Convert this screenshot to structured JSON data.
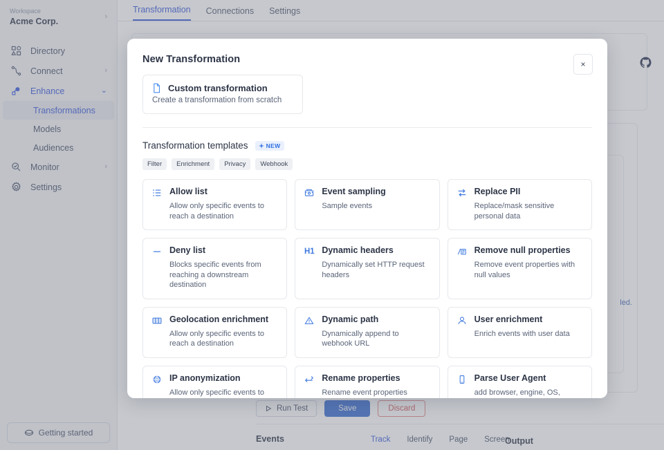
{
  "sidebar": {
    "workspace_label": "Workspace",
    "workspace_name": "Acme Corp.",
    "items": [
      {
        "label": "Directory",
        "icon": "directory-icon",
        "chevron": ""
      },
      {
        "label": "Connect",
        "icon": "connect-icon",
        "chevron": "›"
      },
      {
        "label": "Enhance",
        "icon": "enhance-icon",
        "chevron": "∨"
      },
      {
        "label": "Monitor",
        "icon": "monitor-icon",
        "chevron": "›"
      },
      {
        "label": "Settings",
        "icon": "settings-icon",
        "chevron": ""
      }
    ],
    "sub_items": [
      {
        "label": "Transformations",
        "selected": true
      },
      {
        "label": "Models",
        "selected": false
      },
      {
        "label": "Audiences",
        "selected": false
      }
    ],
    "getting_started": "Getting started"
  },
  "main": {
    "tabs": [
      {
        "label": "Transformation",
        "active": true
      },
      {
        "label": "Connections",
        "active": false
      },
      {
        "label": "Settings",
        "active": false
      }
    ],
    "faint_text": "led.",
    "actions": {
      "run_test": "Run Test",
      "save": "Save",
      "discard": "Discard"
    },
    "events": {
      "label": "Events",
      "output_label": "Output",
      "tabs": [
        {
          "label": "Track",
          "active": true
        },
        {
          "label": "Identify",
          "active": false
        },
        {
          "label": "Page",
          "active": false
        },
        {
          "label": "Screen",
          "active": false
        }
      ]
    }
  },
  "modal": {
    "title": "New Transformation",
    "close_label": "×",
    "custom": {
      "title": "Custom transformation",
      "subtitle": "Create a transformation from scratch",
      "icon": "file-icon"
    },
    "templates_heading": "Transformation templates",
    "new_badge": "NEW",
    "chips": [
      "Filter",
      "Enrichment",
      "Privacy",
      "Webhook"
    ],
    "templates": [
      {
        "title": "Allow list",
        "subtitle": "Allow only specific events to reach a destination",
        "icon": "list-icon"
      },
      {
        "title": "Event sampling",
        "subtitle": "Sample events",
        "icon": "sampling-icon"
      },
      {
        "title": "Replace PII",
        "subtitle": "Replace/mask sensitive personal data",
        "icon": "swap-arrows-icon"
      },
      {
        "title": "Deny list",
        "subtitle": "Blocks specific events from reaching a downstream destination",
        "icon": "minus-icon"
      },
      {
        "title": "Dynamic headers",
        "subtitle": "Dynamically set HTTP request headers",
        "icon": "h1-icon"
      },
      {
        "title": "Remove null properties",
        "subtitle": "Remove event properties with null values",
        "icon": "remove-null-icon"
      },
      {
        "title": "Geolocation enrichment",
        "subtitle": "Allow only specific events to reach a destination",
        "icon": "map-icon"
      },
      {
        "title": "Dynamic path",
        "subtitle": "Dynamically append to webhook URL",
        "icon": "warning-triangle-icon"
      },
      {
        "title": "User enrichment",
        "subtitle": "Enrich events with user data",
        "icon": "user-icon"
      },
      {
        "title": "IP anonymization",
        "subtitle": "Allow only specific events to reach a destination",
        "icon": "globe-icon"
      },
      {
        "title": "Rename properties",
        "subtitle": "Rename event properties",
        "icon": "rename-icon"
      },
      {
        "title": "Parse User Agent",
        "subtitle": "add browser, engine, OS, device and CPU data to events.",
        "icon": "mobile-icon"
      }
    ]
  },
  "colors": {
    "accent": "#3b5bdb",
    "accent_blue": "#2f6fe0",
    "danger": "#d05a5a",
    "text_primary": "#2c3446",
    "text_secondary": "#5a6478",
    "sidebar_bg": "#f4f5f7"
  }
}
